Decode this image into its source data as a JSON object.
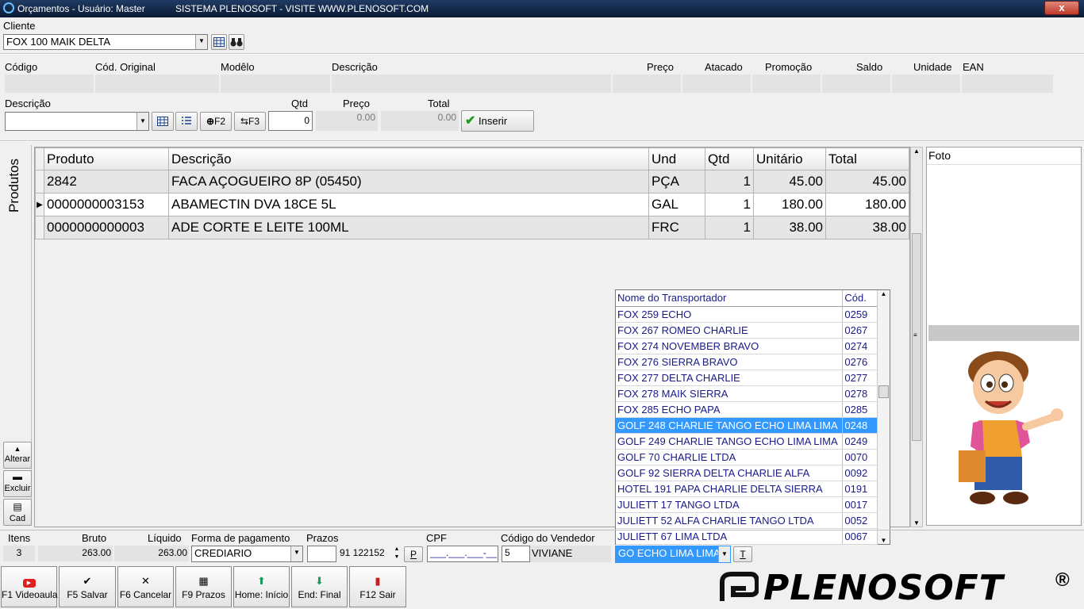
{
  "window": {
    "title": "Orçamentos - Usuário: Master",
    "banner": "SISTEMA PLENOSOFT - VISITE WWW.PLENOSOFT.COM",
    "close": "x"
  },
  "cliente": {
    "label": "Cliente",
    "value": "FOX 100 MAIK DELTA"
  },
  "product_fields": [
    "Código",
    "Cód. Original",
    "Modêlo",
    "Descrição",
    "Preço",
    "Atacado",
    "Promoção",
    "Saldo",
    "Unidade",
    "EAN"
  ],
  "entry": {
    "descricao_label": "Descrição",
    "qtd_label": "Qtd",
    "qtd_value": "0",
    "preco_label": "Preço",
    "preco_value": "0.00",
    "total_label": "Total",
    "total_value": "0.00",
    "f2": "F2",
    "f3": "F3",
    "inserir": "Inserir"
  },
  "side": {
    "produtos": "Produtos",
    "alterar": "Alterar",
    "excluir": "Excluir",
    "cad": "Cad"
  },
  "grid": {
    "headers": [
      "Produto",
      "Descrição",
      "Und",
      "Qtd",
      "Unitário",
      "Total"
    ],
    "rows": [
      [
        "2842",
        "FACA AÇOGUEIRO 8P (05450)",
        "PÇA",
        "1",
        "45.00",
        "45.00"
      ],
      [
        "0000000003153",
        "ABAMECTIN DVA 18CE 5L",
        "GAL",
        "1",
        "180.00",
        "180.00"
      ],
      [
        "0000000000003",
        "ADE CORTE E LEITE 100ML",
        "FRC",
        "1",
        "38.00",
        "38.00"
      ]
    ]
  },
  "foto": {
    "label": "Foto"
  },
  "transportador": {
    "headers": [
      "Nome do Transportador",
      "Cód."
    ],
    "rows": [
      [
        "FOX 259 ECHO",
        "0259"
      ],
      [
        "FOX 267 ROMEO CHARLIE",
        "0267"
      ],
      [
        "FOX 274 NOVEMBER BRAVO",
        "0274"
      ],
      [
        "FOX 276 SIERRA BRAVO",
        "0276"
      ],
      [
        "FOX 277 DELTA CHARLIE",
        "0277"
      ],
      [
        "FOX 278 MAIK SIERRA",
        "0278"
      ],
      [
        "FOX 285 ECHO PAPA",
        "0285"
      ],
      [
        "GOLF 248 CHARLIE TANGO ECHO LIMA LIMA",
        "0248"
      ],
      [
        "GOLF 249 CHARLIE TANGO ECHO LIMA LIMA",
        "0249"
      ],
      [
        "GOLF 70 CHARLIE LTDA",
        "0070"
      ],
      [
        "GOLF 92 SIERRA DELTA CHARLIE ALFA",
        "0092"
      ],
      [
        "HOTEL 191 PAPA CHARLIE DELTA SIERRA",
        "0191"
      ],
      [
        "JULIETT 17 TANGO LTDA",
        "0017"
      ],
      [
        "JULIETT 52 ALFA CHARLIE TANGO LTDA",
        "0052"
      ],
      [
        "JULIETT 67 LIMA LTDA",
        "0067"
      ]
    ],
    "selected_index": 7,
    "combo_value": "GO ECHO LIMA LIMA",
    "t_button": "T"
  },
  "footer": {
    "itens_label": "Itens",
    "itens_value": "3",
    "bruto_label": "Bruto",
    "bruto_value": "263.00",
    "liquido_label": "Líquido",
    "liquido_value": "263.00",
    "forma_label": "Forma de pagamento",
    "forma_value": "CREDIARIO",
    "prazos_label": "Prazos",
    "prazos_value": "91 122152",
    "p_button": "P",
    "cpf_label": "CPF",
    "cpf_value": "___.___.___-__",
    "vendedor_label": "Código do Vendedor",
    "vendedor_code": "5",
    "vendedor_name": "VIVIANE"
  },
  "fkeys": [
    {
      "label": "F1 Videoaula",
      "icon": "youtube-icon"
    },
    {
      "label": "F5 Salvar",
      "icon": "check-icon"
    },
    {
      "label": "F6 Cancelar",
      "icon": "x-icon"
    },
    {
      "label": "F9 Prazos",
      "icon": "calendar-icon"
    },
    {
      "label": "Home: Início",
      "icon": "arrow-up-icon"
    },
    {
      "label": "End: Final",
      "icon": "arrow-down-icon"
    },
    {
      "label": "F12 Sair",
      "icon": "exit-icon"
    }
  ],
  "brand": {
    "logo_text": "PLENOSOFT",
    "registered": "®"
  },
  "colors": {
    "selection": "#3399ff",
    "dropdown_text": "#1a1a8a",
    "check_green": "#1e9a1e"
  }
}
